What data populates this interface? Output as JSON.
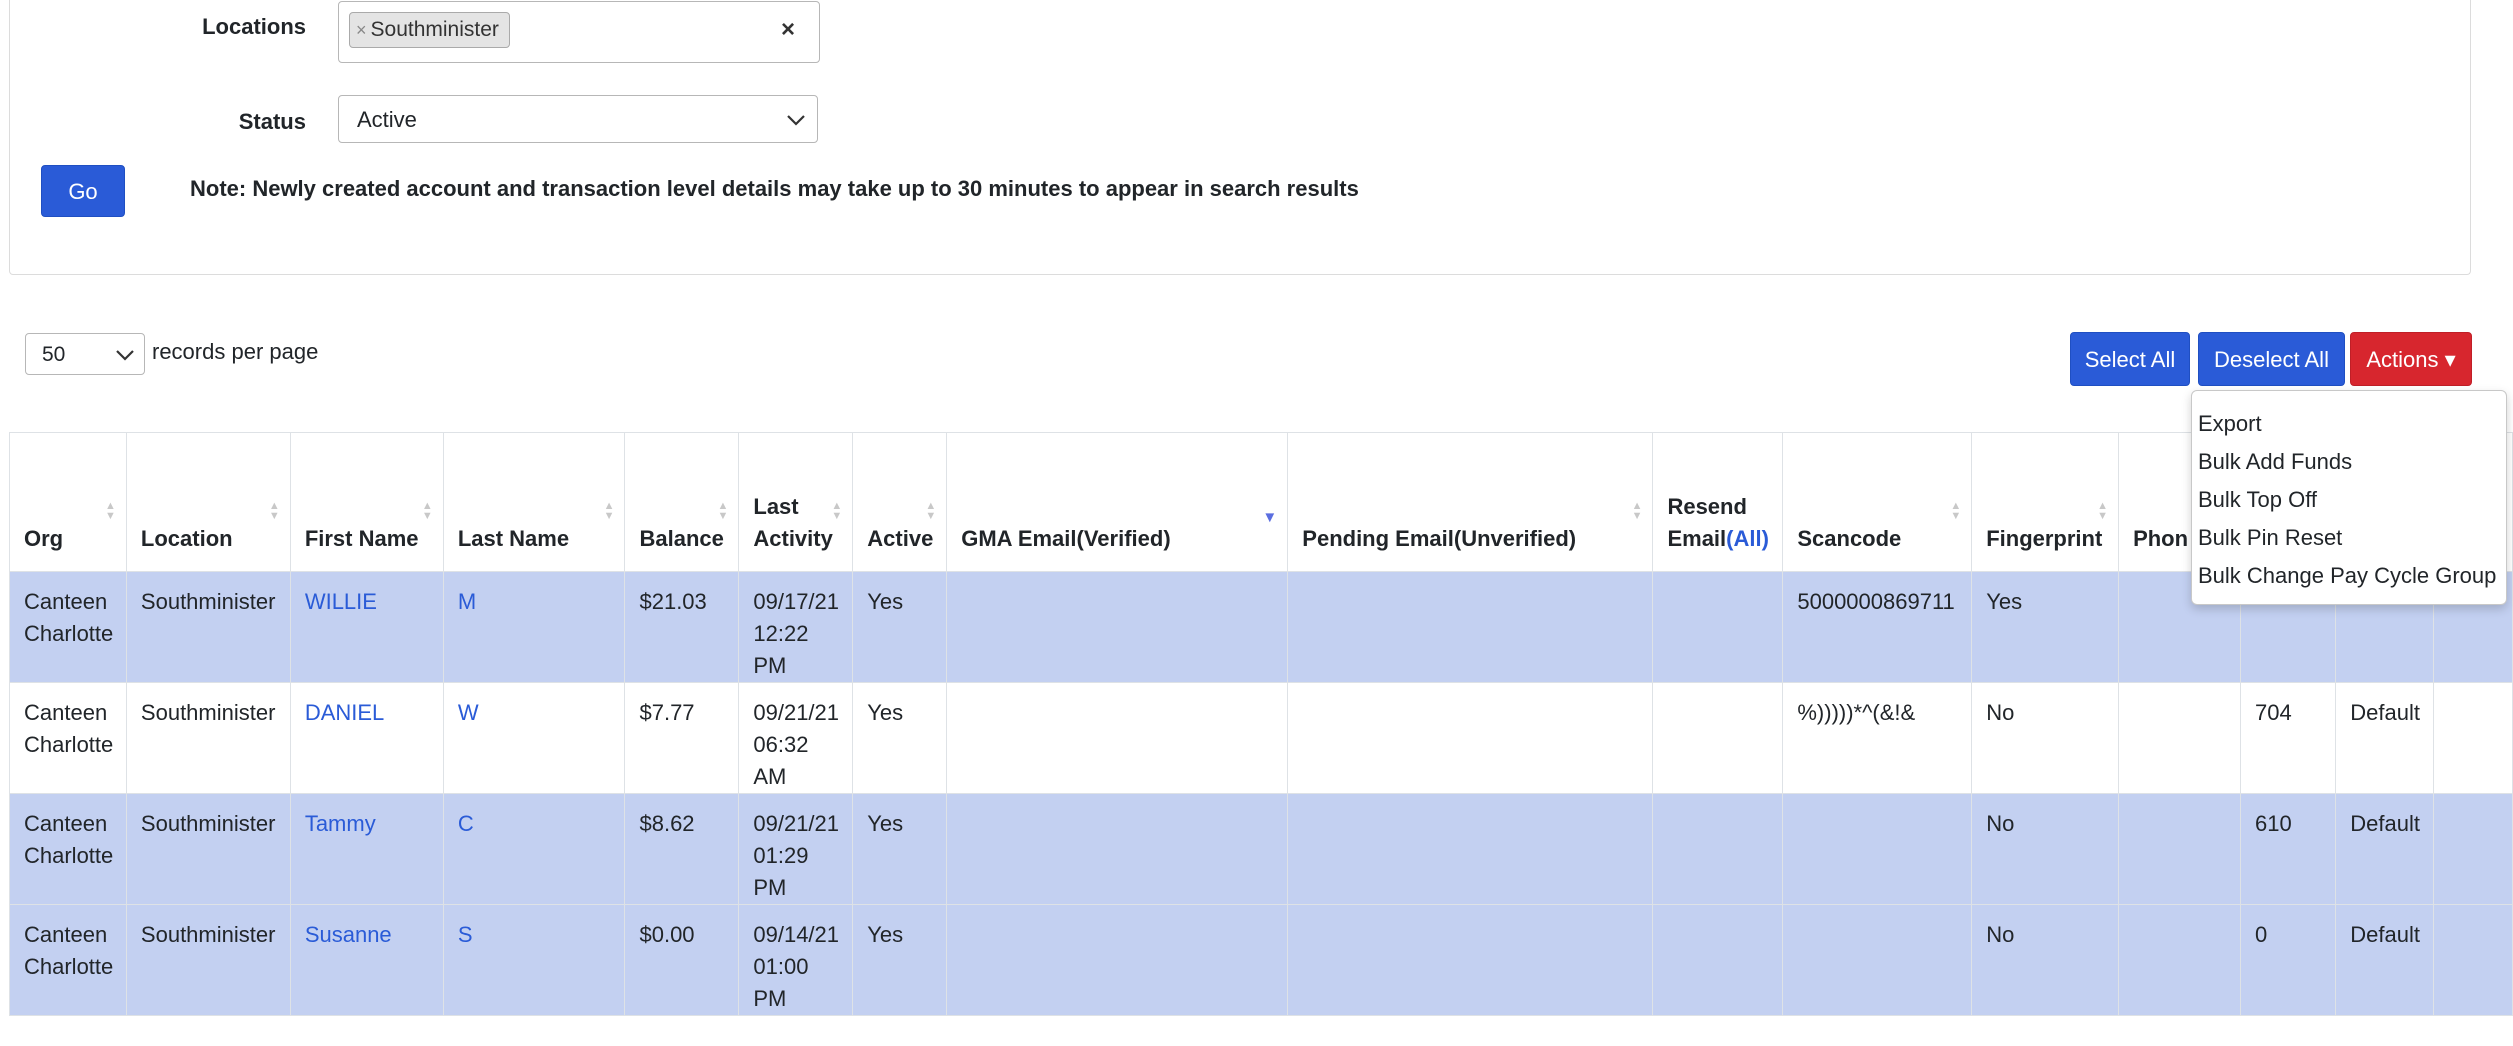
{
  "filters": {
    "locations_label": "Locations",
    "location_chip": "Southminister",
    "chip_remove": "×",
    "clear_symbol": "×",
    "status_label": "Status",
    "status_value": "Active",
    "go_label": "Go",
    "note": "Note: Newly created account and transaction level details may take up to 30 minutes to appear in search results"
  },
  "paging": {
    "per_page_value": "50",
    "per_page_label": "records per page"
  },
  "toolbar": {
    "select_all": "Select All",
    "deselect_all": "Deselect All",
    "actions": "Actions ▾"
  },
  "actions_menu": [
    "Export",
    "Bulk Add Funds",
    "Bulk Top Off",
    "Bulk Pin Reset",
    "Bulk Change Pay Cycle Group"
  ],
  "table": {
    "headers": {
      "org": "Org",
      "location": "Location",
      "first_name": "First Name",
      "last_name": "Last Name",
      "balance": "Balance",
      "last_activity_1": "Last",
      "last_activity_2": "Activity",
      "active": "Active",
      "gma_email": "GMA Email(Verified)",
      "pending_email": "Pending Email(Unverified)",
      "resend_1": "Resend",
      "resend_2": "Email",
      "resend_all": "(All)",
      "scancode": "Scancode",
      "fingerprint": "Fingerprint",
      "phone": "Phon"
    },
    "rows": [
      {
        "org1": "Canteen",
        "org2": "Charlotte",
        "location": "Southminister",
        "first": "WILLIE",
        "last": "M",
        "balance": "$21.03",
        "act1": "09/17/21",
        "act2": "12:22",
        "act3": "PM",
        "active": "Yes",
        "gma": "",
        "pending": "",
        "resend": "",
        "scancode": "5000000869711",
        "fingerprint": "Yes",
        "phone": "",
        "c1": "",
        "c2": ""
      },
      {
        "org1": "Canteen",
        "org2": "Charlotte",
        "location": "Southminister",
        "first": "DANIEL",
        "last": "W",
        "balance": "$7.77",
        "act1": "09/21/21",
        "act2": "06:32",
        "act3": "AM",
        "active": "Yes",
        "gma": "",
        "pending": "",
        "resend": "",
        "scancode": "%)))))*^(&!&",
        "fingerprint": "No",
        "phone": "",
        "c1": "704",
        "c2": "Default"
      },
      {
        "org1": "Canteen",
        "org2": "Charlotte",
        "location": "Southminister",
        "first": "Tammy",
        "last": "C",
        "balance": "$8.62",
        "act1": "09/21/21",
        "act2": "01:29",
        "act3": "PM",
        "active": "Yes",
        "gma": "",
        "pending": "",
        "resend": "",
        "scancode": "",
        "fingerprint": "No",
        "phone": "",
        "c1": "610",
        "c2": "Default"
      },
      {
        "org1": "Canteen",
        "org2": "Charlotte",
        "location": "Southminister",
        "first": "Susanne",
        "last": "S",
        "balance": "$0.00",
        "act1": "09/14/21",
        "act2": "01:00",
        "act3": "PM",
        "active": "Yes",
        "gma": "",
        "pending": "",
        "resend": "",
        "scancode": "",
        "fingerprint": "No",
        "phone": "",
        "c1": "0",
        "c2": "Default"
      }
    ]
  }
}
